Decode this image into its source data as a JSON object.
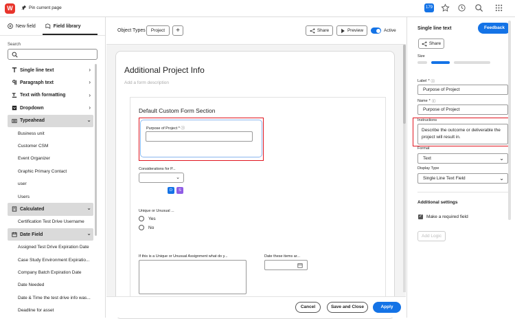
{
  "topbar": {
    "logo_letter": "W",
    "pin_label": "Pin current page",
    "notification_count": "179",
    "icons": [
      "star-icon",
      "history-icon",
      "search-icon",
      "apps-grid-icon"
    ]
  },
  "left_panel": {
    "tabs": [
      {
        "label": "New field",
        "icon": "plus-circle-icon"
      },
      {
        "label": "Field library",
        "icon": "book-icon",
        "selected": true
      }
    ],
    "search": {
      "label": "Search",
      "placeholder": ""
    },
    "items": [
      {
        "kind": "type",
        "label": "Single line text",
        "icon": "text-icon"
      },
      {
        "kind": "type",
        "label": "Paragraph text",
        "icon": "paragraph-icon"
      },
      {
        "kind": "type",
        "label": "Text with formatting",
        "icon": "format-text-icon"
      },
      {
        "kind": "type",
        "label": "Dropdown",
        "icon": "dropdown-icon"
      },
      {
        "kind": "group",
        "label": "Typeahead",
        "icon": "typeahead-icon"
      },
      {
        "kind": "sub",
        "label": "Business unit"
      },
      {
        "kind": "sub",
        "label": "Customer CSM"
      },
      {
        "kind": "sub",
        "label": "Event Organizer"
      },
      {
        "kind": "sub",
        "label": "Graphic Primary Contact"
      },
      {
        "kind": "sub",
        "label": "user"
      },
      {
        "kind": "sub",
        "label": "Users"
      },
      {
        "kind": "group",
        "label": "Calculated",
        "icon": "calculator-icon"
      },
      {
        "kind": "sub",
        "label": "Certification Test Drive Username"
      },
      {
        "kind": "group",
        "label": "Date Field",
        "icon": "calendar-icon"
      },
      {
        "kind": "sub",
        "label": "Assigned Test Drive Expiration Date"
      },
      {
        "kind": "sub",
        "label": "Case Study Environment Expiratio..."
      },
      {
        "kind": "sub",
        "label": "Company Batch Expiration Date"
      },
      {
        "kind": "sub",
        "label": "Date Needed"
      },
      {
        "kind": "sub",
        "label": "Date & Time the test drive info was..."
      },
      {
        "kind": "sub",
        "label": "Deadline for asset"
      }
    ]
  },
  "center": {
    "object_types_label": "Object Types",
    "object_type": "Project",
    "share_label": "Share",
    "preview_label": "Preview",
    "active_label": "Active",
    "form_title": "Additional Project Info",
    "form_description_placeholder": "Add a form description",
    "section_title": "Default Custom Form Section",
    "purpose_field_label": "Purpose of Project",
    "considerations_label": "Considerations for P...",
    "tag_d": "D",
    "tag_s": "S",
    "unusual_label": "Unique or Unusual ...",
    "radio_yes": "Yes",
    "radio_no": "No",
    "if_this_label": "If this is a Unique or Unusual Assignment what do y...",
    "date_label": "Date these items ar...",
    "cancel_label": "Cancel",
    "save_close_label": "Save and Close",
    "apply_label": "Apply"
  },
  "right_panel": {
    "title": "Single line text",
    "feedback_label": "Feedback",
    "share_label": "Share",
    "size_label": "Size",
    "label_label": "Label",
    "label_value": "Purpose of Project",
    "name_label": "Name",
    "name_value": "Purpose of Project",
    "instructions_label": "Instructions",
    "instructions_value": "Describe the outcome or deliverable the project will result in.",
    "format_label": "Format",
    "format_value": "Text",
    "display_type_label": "Display Type",
    "display_type_value": "Single Line Text Field",
    "additional_settings": "Additional settings",
    "required_label": "Make a required field",
    "add_logic_label": "Add Logic"
  },
  "colors": {
    "accent": "#1473e6",
    "highlight": "#e0141e",
    "tag_s": "#8f5ce5"
  }
}
